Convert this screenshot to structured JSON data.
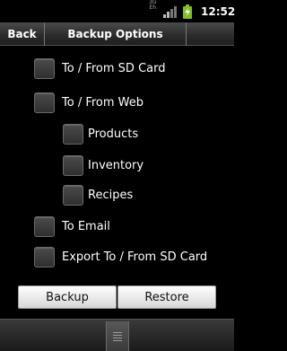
{
  "status_bar": {
    "network_type_top": "3G",
    "network_type_bottom": "Eh",
    "time": "12:52"
  },
  "title_bar": {
    "back_label": "Back",
    "title": "Backup Options"
  },
  "options": [
    {
      "label": "To / From SD Card",
      "checked": false
    },
    {
      "label": "To / From Web",
      "checked": false
    },
    {
      "label": "Products",
      "checked": false
    },
    {
      "label": "Inventory",
      "checked": false
    },
    {
      "label": "Recipes",
      "checked": false
    },
    {
      "label": "To Email",
      "checked": false
    },
    {
      "label": "Export To / From SD Card",
      "checked": false
    }
  ],
  "buttons": {
    "backup_label": "Backup",
    "restore_label": "Restore"
  },
  "icons": {
    "signal": "signal-strength-icon",
    "battery": "battery-charging-icon",
    "menu": "menu-handle-icon"
  },
  "colors": {
    "battery_fill": "#7ec11e",
    "background": "#000000"
  }
}
